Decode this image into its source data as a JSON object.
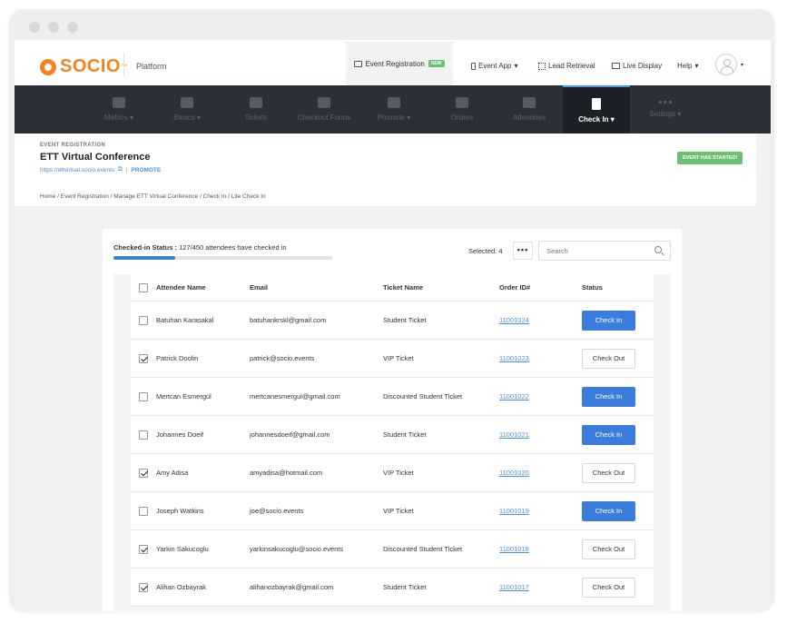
{
  "brand": {
    "name": "SOCIO",
    "tm": "™",
    "platform": "Platform",
    "accent": "#f5821f"
  },
  "topnav": {
    "event_registration": "Event Registration",
    "new_badge": "NEW",
    "event_app": "Event App",
    "lead_retrieval": "Lead Retrieval",
    "live_display": "Live Display",
    "help": "Help"
  },
  "tabs": [
    {
      "label": "Metrics",
      "caret": true
    },
    {
      "label": "Basics",
      "caret": true
    },
    {
      "label": "Tickets",
      "caret": false
    },
    {
      "label": "Checkout Forms",
      "caret": false
    },
    {
      "label": "Promote",
      "caret": true
    },
    {
      "label": "Orders",
      "caret": false
    },
    {
      "label": "Attendees",
      "caret": false
    },
    {
      "label": "Check In",
      "caret": true,
      "active": true
    },
    {
      "label": "Settings",
      "caret": true
    }
  ],
  "event": {
    "kicker": "EVENT REGISTRATION",
    "title": "ETT Virtual Conference",
    "url": "https://ettvirtual.socio.events",
    "promote": "PROMOTE",
    "status_badge": "EVENT HAS STARTED!"
  },
  "breadcrumb": "Home / Event Registration / Manage ETT Virtual Conference / Check In / Lite Check In",
  "checkin": {
    "status_label": "Checked-in Status :",
    "status_text": "127/450 attendees have checked in",
    "progress": 0.282,
    "selected": "Selected: 4",
    "more": "•••",
    "search_placeholder": "Search"
  },
  "table": {
    "headers": {
      "name": "Attendee Name",
      "email": "Email",
      "ticket": "Ticket Name",
      "order": "Order ID#",
      "status": "Status"
    },
    "rows": [
      {
        "checked": false,
        "name": "Batuhan Karasakal",
        "email": "batuhankrskl@gmail.com",
        "ticket": "Student Ticket",
        "order": "11001024",
        "action": "Check In"
      },
      {
        "checked": true,
        "name": "Patrick Doolin",
        "email": "patrick@socio.events",
        "ticket": "VIP Ticket",
        "order": "11001023",
        "action": "Check Out"
      },
      {
        "checked": false,
        "name": "Mertcan Esmergül",
        "email": "mertcanesmergul@gmail.com",
        "ticket": "Discounted Student Ticket",
        "order": "11001022",
        "action": "Check In"
      },
      {
        "checked": false,
        "name": "Johannes Doeif",
        "email": "johannesdoeif@gmail.com",
        "ticket": "Student Ticket",
        "order": "11001021",
        "action": "Check In"
      },
      {
        "checked": true,
        "name": "Amy Adisa",
        "email": "amyadisa@hotmail.com",
        "ticket": "VIP Ticket",
        "order": "11001020",
        "action": "Check Out"
      },
      {
        "checked": false,
        "name": "Joseph Watkins",
        "email": "joe@socio.events",
        "ticket": "VIP Ticket",
        "order": "11001019",
        "action": "Check In"
      },
      {
        "checked": true,
        "name": "Yarkin Sakucoglu",
        "email": "yarkinsakucoglu@socio.events",
        "ticket": "Discounted Student Ticket",
        "order": "11001018",
        "action": "Check Out"
      },
      {
        "checked": true,
        "name": "Alihan Ozbayrak",
        "email": "alihanozbayrak@gmail.com",
        "ticket": "Student Ticket",
        "order": "11001017",
        "action": "Check Out"
      }
    ]
  }
}
